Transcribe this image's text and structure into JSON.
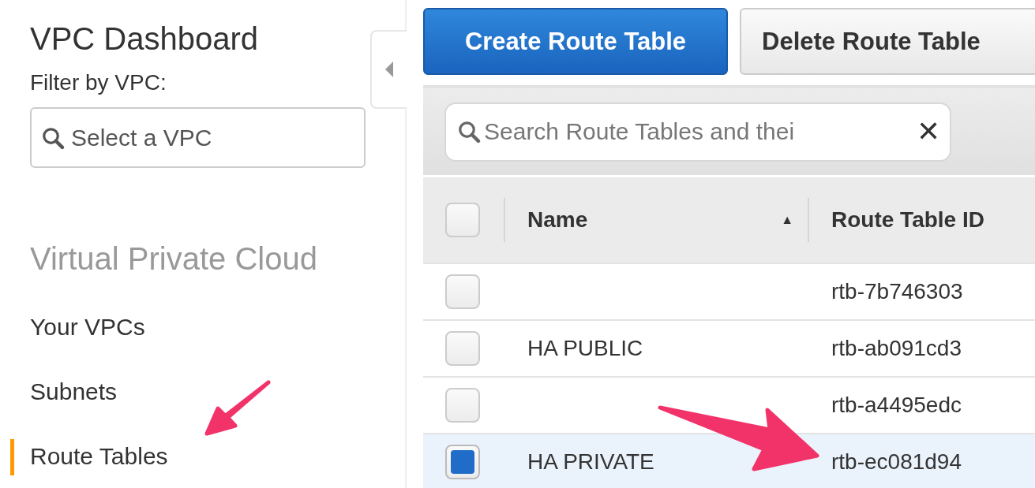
{
  "sidebar": {
    "title": "VPC Dashboard",
    "filter_label": "Filter by VPC:",
    "filter": {
      "placeholder": "Select a VPC"
    },
    "section": "Virtual Private Cloud",
    "items": [
      {
        "label": "Your VPCs",
        "selected": false
      },
      {
        "label": "Subnets",
        "selected": false
      },
      {
        "label": "Route Tables",
        "selected": true
      }
    ]
  },
  "toolbar": {
    "buttons": [
      {
        "label": "Create Route Table",
        "kind": "primary"
      },
      {
        "label": "Delete Route Table",
        "kind": "secondary"
      }
    ]
  },
  "search": {
    "placeholder": "Search Route Tables and thei",
    "clear": "✕"
  },
  "table": {
    "select_all": {
      "checked": false
    },
    "columns": [
      {
        "label": "Name",
        "sort": "▲"
      },
      {
        "label": "Route Table ID"
      }
    ],
    "rows": [
      {
        "name": "",
        "id": "rtb-7b746303",
        "selected": false
      },
      {
        "name": "HA PUBLIC",
        "id": "rtb-ab091cd3",
        "selected": false
      },
      {
        "name": "",
        "id": "rtb-a4495edc",
        "selected": false
      },
      {
        "name": "HA PRIVATE",
        "id": "rtb-ec081d94",
        "selected": true
      }
    ]
  }
}
